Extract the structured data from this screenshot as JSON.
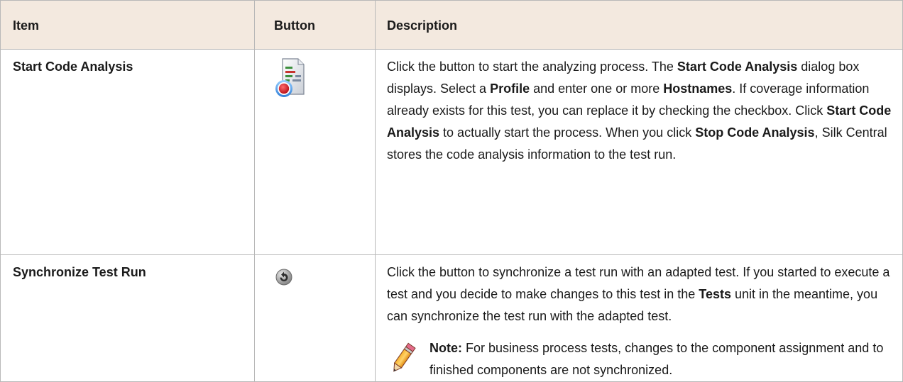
{
  "header": {
    "item": "Item",
    "button": "Button",
    "description": "Description"
  },
  "rows": [
    {
      "item": "Start Code Analysis",
      "icon": "code-analysis-icon",
      "description": [
        {
          "t": "Click the button to start the analyzing process. The ",
          "b": false
        },
        {
          "t": "Start Code Analysis",
          "b": true
        },
        {
          "t": " dialog box displays. Select a ",
          "b": false
        },
        {
          "t": "Profile",
          "b": true
        },
        {
          "t": " and enter one or more ",
          "b": false
        },
        {
          "t": "Hostnames",
          "b": true
        },
        {
          "t": ". If coverage information already exists for this test, you can replace it by checking the checkbox. Click ",
          "b": false
        },
        {
          "t": "Start Code Analysis",
          "b": true
        },
        {
          "t": " to actually start the process. When you click ",
          "b": false
        },
        {
          "t": "Stop Code Analysis",
          "b": true
        },
        {
          "t": ", Silk Central stores the code analysis information to the test run.",
          "b": false
        }
      ]
    },
    {
      "item": "Synchronize Test Run",
      "icon": "synchronize-icon",
      "description": [
        {
          "t": "Click the button to synchronize a test run with an adapted test. If you started to execute a test and you decide to make changes to this test in the ",
          "b": false
        },
        {
          "t": "Tests",
          "b": true
        },
        {
          "t": " unit in the meantime, you can synchronize the test run with the adapted test.",
          "b": false
        }
      ],
      "note": {
        "label": "Note:",
        "text": " For business process tests, changes to the component assignment and to finished components are not synchronized.",
        "icon": "pencil-note-icon"
      }
    }
  ],
  "colors": {
    "header_bg": "#f3e9df",
    "border": "#b8b8b8"
  }
}
